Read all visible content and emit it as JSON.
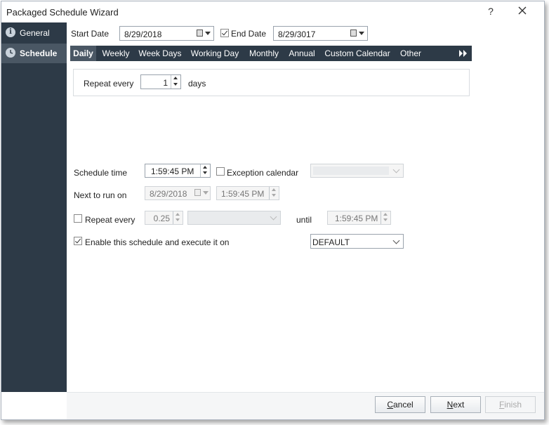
{
  "window": {
    "title": "Packaged Schedule Wizard",
    "help_label": "?"
  },
  "sidebar": {
    "items": [
      {
        "label": "General",
        "icon": "info-icon",
        "active": false
      },
      {
        "label": "Schedule",
        "icon": "clock-icon",
        "active": true
      }
    ]
  },
  "dates": {
    "start_label": "Start Date",
    "start_value": "8/29/2018",
    "end_label": "End Date",
    "end_checked": true,
    "end_value": "8/29/3017"
  },
  "tabs": [
    "Daily",
    "Weekly",
    "Week Days",
    "Working Day",
    "Monthly",
    "Annual",
    "Custom Calendar",
    "Other"
  ],
  "active_tab": "Daily",
  "repeat_daily": {
    "label": "Repeat every",
    "value": "1",
    "unit": "days"
  },
  "schedule_time": {
    "label": "Schedule time",
    "value": "1:59:45 PM"
  },
  "exception": {
    "label": "Exception calendar",
    "checked": false,
    "value": ""
  },
  "next_run": {
    "label": "Next to run on",
    "date": "8/29/2018",
    "time": "1:59:45 PM"
  },
  "repeat_interval": {
    "label": "Repeat every",
    "checked": false,
    "value": "0.25",
    "unit_value": "",
    "until_label": "until",
    "until_value": "1:59:45 PM"
  },
  "enable": {
    "label": "Enable this schedule and execute it on",
    "checked": true,
    "value": "DEFAULT"
  },
  "footer": {
    "cancel": {
      "prefix": "",
      "underline": "C",
      "rest": "ancel"
    },
    "next": {
      "prefix": "",
      "underline": "N",
      "rest": "ext"
    },
    "finish": {
      "prefix": "",
      "underline": "F",
      "rest": "inish"
    }
  }
}
